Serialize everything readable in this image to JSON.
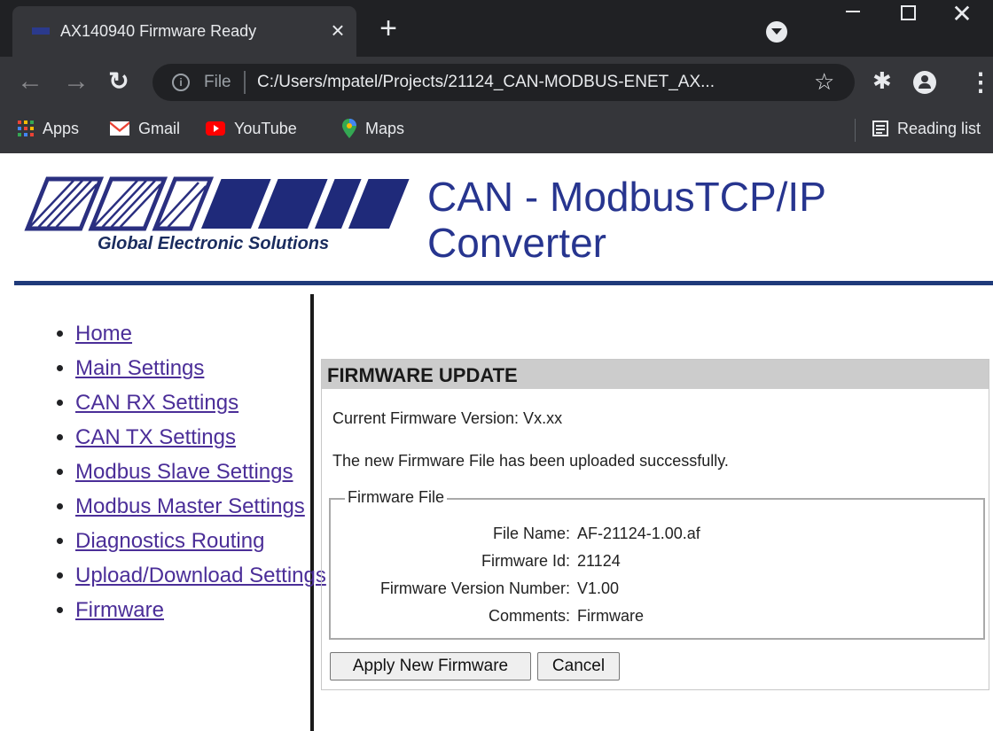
{
  "browser": {
    "tab_title": "AX140940 Firmware Ready",
    "tab_close": "×",
    "new_tab": "+",
    "url_scheme": "File",
    "url_path": "C:/Users/mpatel/Projects/21124_CAN-MODBUS-ENET_AX...",
    "icons": [
      "back-arrow-icon",
      "forward-arrow-icon",
      "reload-icon",
      "info-icon",
      "star-icon",
      "extensions-icon",
      "profile-icon",
      "menu-icon",
      "tab-search-icon"
    ],
    "bookmarks": [
      {
        "label": "Apps",
        "icon": "apps-grid-icon"
      },
      {
        "label": "Gmail",
        "icon": "gmail-icon"
      },
      {
        "label": "YouTube",
        "icon": "youtube-icon"
      },
      {
        "label": "Maps",
        "icon": "maps-icon"
      }
    ],
    "reading_list": "Reading list"
  },
  "header": {
    "logo_tagline": "Global Electronic Solutions",
    "title": "CAN - ModbusTCP/IP Converter"
  },
  "nav": {
    "items": [
      {
        "label": "Home"
      },
      {
        "label": "Main Settings"
      },
      {
        "label": "CAN RX Settings"
      },
      {
        "label": "CAN TX Settings"
      },
      {
        "label": "Modbus Slave Settings"
      },
      {
        "label": "Modbus Master Settings"
      },
      {
        "label": "Diagnostics Routing"
      },
      {
        "label": "Upload/Download Settings"
      },
      {
        "label": "Firmware"
      }
    ]
  },
  "panel": {
    "title": "FIRMWARE UPDATE",
    "current_version": "Current Firmware Version: Vx.xx",
    "message": "The new Firmware File has been uploaded successfully.",
    "fieldset_legend": "Firmware File",
    "rows": [
      {
        "key": "File Name:",
        "value": "AF-21124-1.00.af"
      },
      {
        "key": "Firmware Id:",
        "value": "21124"
      },
      {
        "key": "Firmware Version Number:",
        "value": "V1.00"
      },
      {
        "key": "Comments:",
        "value": "Firmware"
      }
    ],
    "apply_label": "Apply New Firmware",
    "cancel_label": "Cancel"
  },
  "colors": {
    "chrome_dark": "#202124",
    "chrome_toolbar": "#35363a",
    "brand_blue": "#27358f",
    "link": "#4b2e98",
    "panel_header": "#cccccc"
  }
}
